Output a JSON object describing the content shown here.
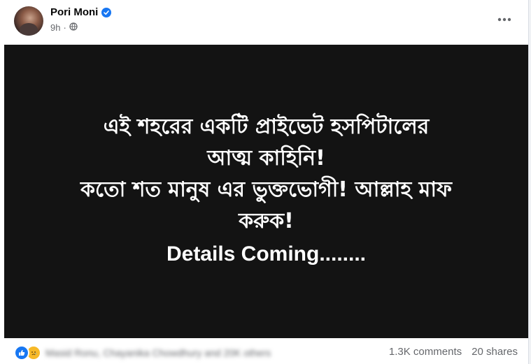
{
  "post": {
    "author": "Pori Moni",
    "time": "9h",
    "image_lines": [
      "এই শহরের একটি প্রাইভেট হসপিটালের",
      "আত্ম কাহিনি!",
      "কতো শত মানুষ এর ভুক্তভোগী! আল্লাহ মাফ",
      "করুক!",
      "Details Coming........"
    ],
    "reactions_text": "Masid Ronu, Chayanika Chowdhury and 20K others",
    "comments": "1.3K comments",
    "shares": "20 shares"
  },
  "icons": {
    "verified": "verified-badge-icon",
    "audience": "globe-icon",
    "more": "more-options-icon",
    "like": "like-reaction-icon",
    "sad": "sad-reaction-icon"
  },
  "colors": {
    "accent": "#1877f2",
    "image_background": "#131313"
  }
}
